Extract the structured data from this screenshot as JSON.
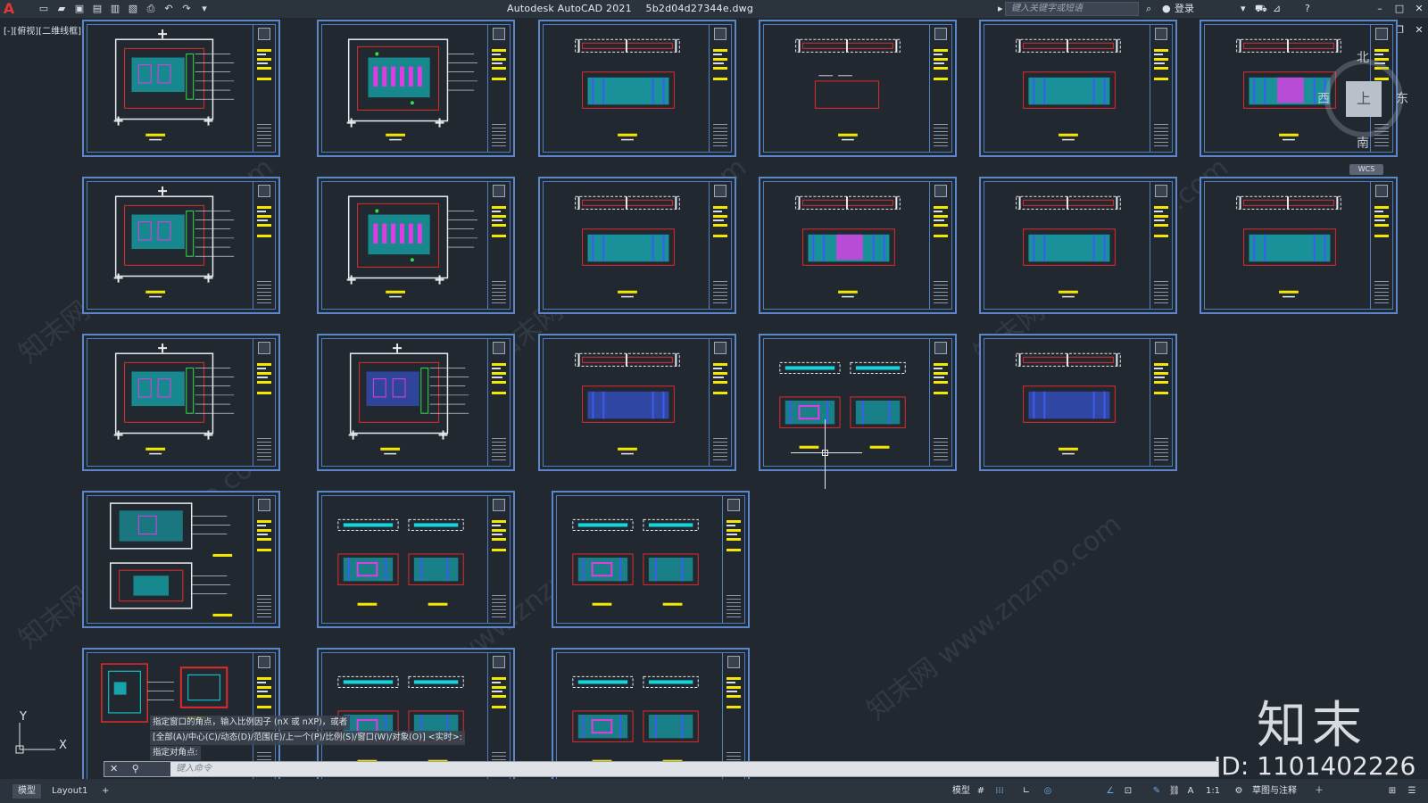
{
  "titlebar": {
    "app_title": "Autodesk AutoCAD 2021",
    "filename": "5b2d04d27344e.dwg",
    "search_placeholder": "键入关键字或短语",
    "login_label": "登录",
    "logo": "A",
    "icons": [
      "new-icon",
      "open-icon",
      "save-icon",
      "saveas-icon",
      "publish-icon",
      "plot-preview-icon",
      "print-icon",
      "undo-icon",
      "redo-icon",
      "customize-icon"
    ]
  },
  "viewport": {
    "label": "[-][俯视][二维线框]"
  },
  "viewcube": {
    "top": "上",
    "north": "北",
    "south": "南",
    "east": "东",
    "west": "西",
    "wcs": "WCS"
  },
  "ucs": {
    "x": "X",
    "y": "Y"
  },
  "command": {
    "history": [
      "指定窗口的角点，输入比例因子 (nX 或 nXP)，或者",
      "[全部(A)/中心(C)/动态(D)/范围(E)/上一个(P)/比例(S)/窗口(W)/对象(O)] <实时>:",
      "指定对角点:"
    ],
    "placeholder": "键入命令",
    "controls": "✕ ⚲"
  },
  "tabs": {
    "model": "模型",
    "layout1": "Layout1",
    "add": "+"
  },
  "status": {
    "model": "模型",
    "grid": "#",
    "snap": "⁞⁞⁞",
    "scale": "1:1",
    "workspace": "草图与注释",
    "items": [
      "∟",
      "◎",
      "∠",
      "⊡",
      "✎",
      "⛓",
      "⚑",
      "A",
      "⚙",
      "＋",
      "⊞",
      "☰"
    ]
  },
  "watermark": {
    "text": "知末网 www.znzmo.com",
    "brand": "知末",
    "id": "ID: 1101402226"
  },
  "colors": {
    "background": "#212830",
    "sheet_border": "#5b87c9",
    "cyan": "#12d7df",
    "red": "#e02b2b",
    "magenta": "#e23be6",
    "yellow": "#f4e800",
    "blue": "#3c5cf2",
    "green": "#2ee04a",
    "white": "#e8ebef"
  },
  "sheets": [
    {
      "kind": "plan"
    },
    {
      "kind": "ceiling"
    },
    {
      "kind": "elevation"
    },
    {
      "kind": "elevation-small"
    },
    {
      "kind": "elevation"
    },
    {
      "kind": "elevation-magenta"
    },
    {
      "kind": "plan"
    },
    {
      "kind": "ceiling"
    },
    {
      "kind": "elevation"
    },
    {
      "kind": "elevation-magenta"
    },
    {
      "kind": "elevation"
    },
    {
      "kind": "elevation"
    },
    {
      "kind": "plan"
    },
    {
      "kind": "plan-blue"
    },
    {
      "kind": "elevation-blue"
    },
    {
      "kind": "double-elevation"
    },
    {
      "kind": "elevation-blue"
    },
    {
      "kind": "double-plan"
    },
    {
      "kind": "double-elevation"
    },
    {
      "kind": "double-elevation"
    },
    {
      "kind": "detail"
    },
    {
      "kind": "double-elevation"
    },
    {
      "kind": "double-elevation"
    }
  ]
}
